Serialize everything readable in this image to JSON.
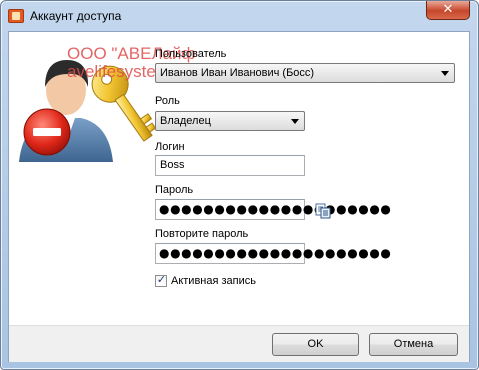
{
  "window": {
    "title": "Аккаунт доступа",
    "close_symbol": "✕"
  },
  "watermark": {
    "line1": "ООО \"АВЕЛайф",
    "line2": "avelifesystems.ru"
  },
  "form": {
    "user": {
      "label": "Пользователь",
      "value": "Иванов Иван Иванович (Босс)"
    },
    "role": {
      "label": "Роль",
      "value": "Владелец"
    },
    "login": {
      "label": "Логин",
      "value": "Boss"
    },
    "password": {
      "label": "Пароль",
      "mask": "●●●●●●●●●●●●●●●●●●●●●"
    },
    "password_repeat": {
      "label": "Повторите пароль",
      "mask": "●●●●●●●●●●●●●●●●●●●●●"
    },
    "active": {
      "label": "Активная запись",
      "checked": true,
      "tick": "✓"
    }
  },
  "buttons": {
    "ok": "OK",
    "cancel": "Отмена"
  },
  "icons": {
    "app": "account-app-icon",
    "illustration": "user-key-delete-icon",
    "copy": "copy-password-icon"
  }
}
